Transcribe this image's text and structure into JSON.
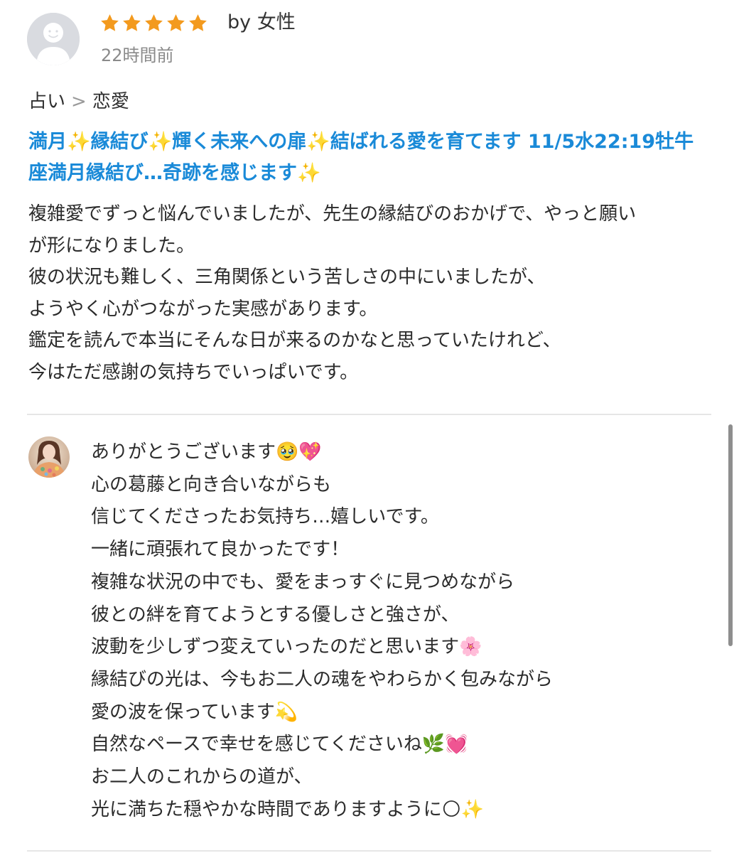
{
  "review": {
    "rating": 5,
    "rating_max": 5,
    "author": "by 女性",
    "time": "22時間前",
    "breadcrumb": {
      "category": "占い",
      "separator": ">",
      "subcategory": "恋愛"
    },
    "service_title": "満月✨縁結び✨輝く未来への扉✨結ばれる愛を育てます 11/5水22:19牡牛座満月縁結び…奇跡を感じます✨",
    "body_lines": [
      "複雑愛でずっと悩んでいましたが、先生の縁結びのおかげで、やっと願い",
      "が形になりました。",
      "彼の状況も難しく、三角関係という苦しさの中にいましたが、",
      "ようやく心がつながった実感があります。",
      "鑑定を読んで本当にそんな日が来るのかなと思っていたけれど、",
      "今はただ感謝の気持ちでいっぱいです。"
    ]
  },
  "reply": {
    "lines": [
      "ありがとうございます🥹💖",
      "心の葛藤と向き合いながらも",
      "信じてくださったお気持ち…嬉しいです。",
      "一緒に頑張れて良かったです！",
      "複雑な状況の中でも、愛をまっすぐに見つめながら",
      "彼との絆を育てようとする優しさと強さが、",
      "波動を少しずつ変えていったのだと思います🌸",
      "縁結びの光は、今もお二人の魂をやわらかく包みながら",
      "愛の波を保っています💫",
      "自然なペースで幸せを感じてくださいね🌿💓",
      "お二人のこれからの道が、",
      "光に満ちた穏やかな時間でありますように🌕✨"
    ]
  },
  "colors": {
    "star": "#f39a1e",
    "title_link": "#1a8ad8",
    "muted_text": "#8a8a8a",
    "divider": "#e6e6e6"
  },
  "icons": {
    "star": "star-icon",
    "avatar": "default-user-avatar-icon",
    "reply_avatar": "seller-avatar-icon"
  }
}
